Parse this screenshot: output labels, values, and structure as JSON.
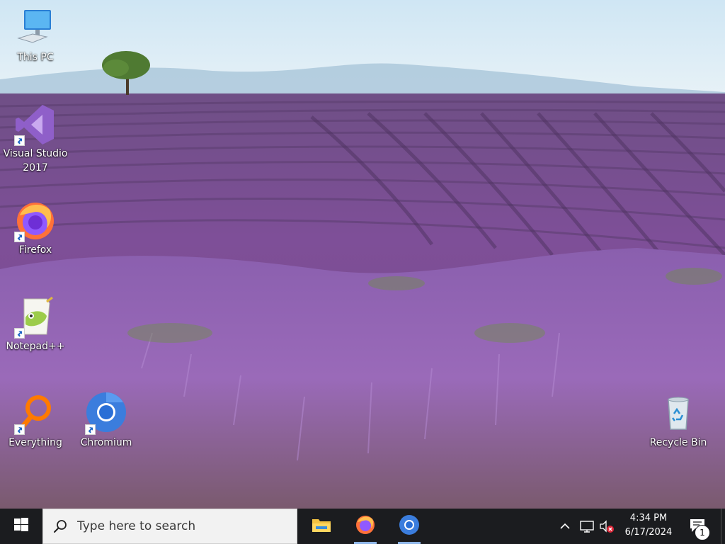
{
  "desktop": {
    "icons": [
      {
        "label": "This PC",
        "icon": "computer-icon"
      },
      {
        "label": "Visual Studio 2017",
        "icon": "visual-studio-icon"
      },
      {
        "label": "Firefox",
        "icon": "firefox-icon"
      },
      {
        "label": "Notepad++",
        "icon": "notepad-plus-plus-icon"
      },
      {
        "label": "Everything",
        "icon": "everything-search-icon"
      },
      {
        "label": "Chromium",
        "icon": "chromium-icon"
      },
      {
        "label": "Recycle Bin",
        "icon": "recycle-bin-icon"
      }
    ]
  },
  "taskbar": {
    "search_placeholder": "Type here to search",
    "pinned_apps": [
      {
        "name": "File Explorer",
        "icon": "folder-icon"
      },
      {
        "name": "Firefox",
        "icon": "firefox-icon"
      },
      {
        "name": "Chromium",
        "icon": "chromium-icon"
      }
    ],
    "tray": {
      "icons": [
        "chevron-up-icon",
        "network-icon",
        "volume-muted-icon"
      ]
    },
    "clock": {
      "time": "4:34 PM",
      "date": "6/17/2024"
    },
    "notification_count": "1"
  },
  "colors": {
    "taskbar_bg": "#1b1c1f",
    "search_bg": "#f2f2f2",
    "accent": "#8fb6e8",
    "lavender": "#8b5aa8"
  }
}
